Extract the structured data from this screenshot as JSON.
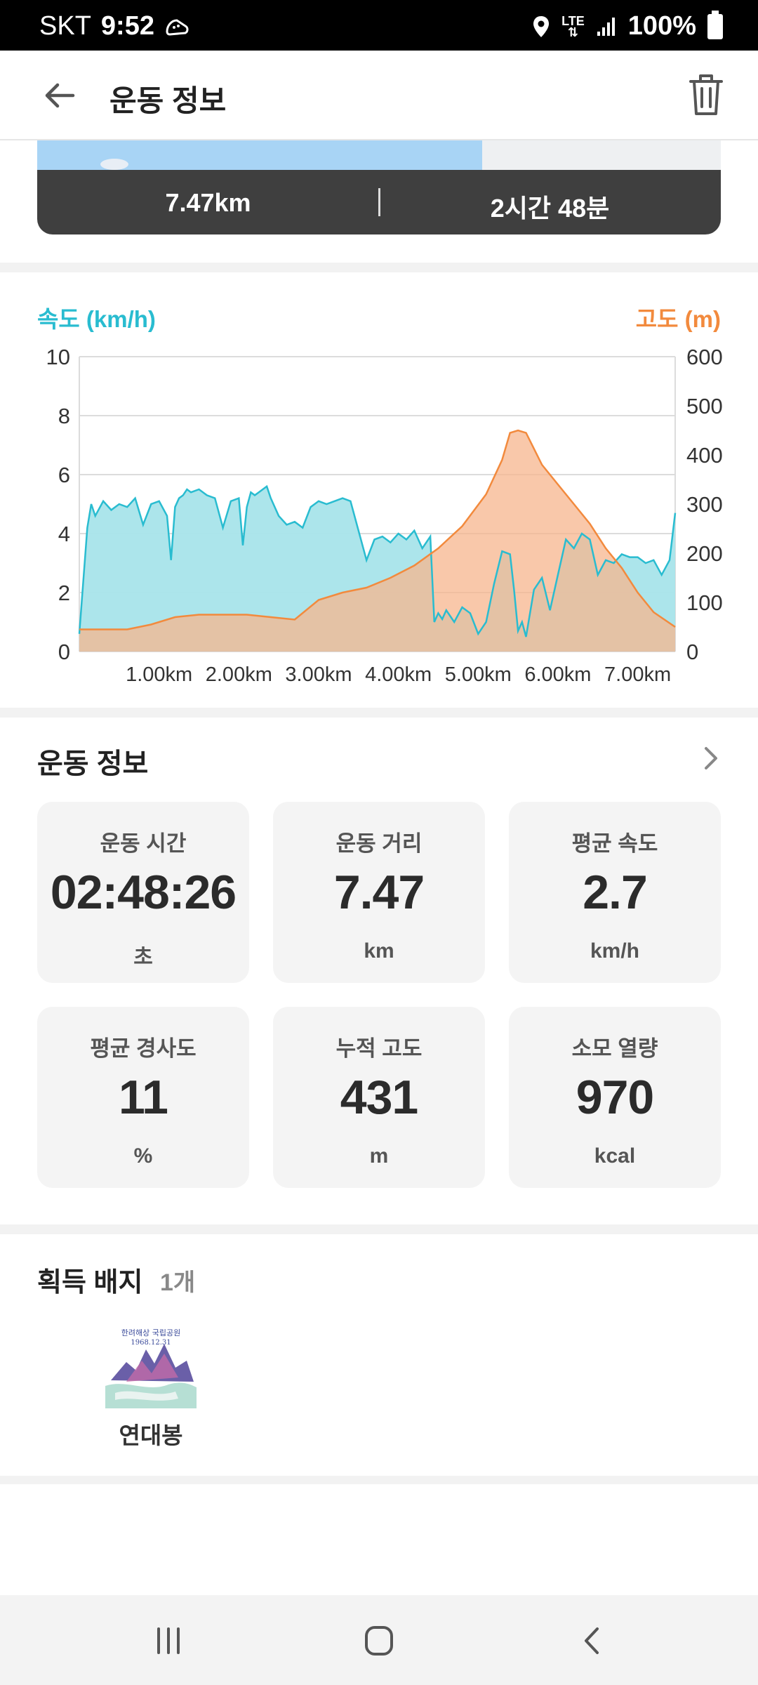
{
  "status_bar": {
    "carrier": "SKT",
    "time": "9:52",
    "network": "LTE",
    "battery": "100%"
  },
  "header": {
    "title": "운동 정보"
  },
  "summary": {
    "distance": "7.47km",
    "duration": "2시간 48분"
  },
  "chart": {
    "left_label": "속도 (km/h)",
    "right_label": "고도 (m)"
  },
  "chart_data": {
    "type": "area",
    "title": "",
    "xlabel": "",
    "x_ticks": [
      "1.00km",
      "2.00km",
      "3.00km",
      "4.00km",
      "5.00km",
      "6.00km",
      "7.00km"
    ],
    "xlim": [
      0,
      7.47
    ],
    "y_left": {
      "label": "속도 (km/h)",
      "ylim": [
        0,
        10
      ],
      "ticks": [
        "0",
        "2",
        "4",
        "6",
        "8",
        "10"
      ]
    },
    "y_right": {
      "label": "고도 (m)",
      "ylim": [
        0,
        600
      ],
      "ticks": [
        "0",
        "100",
        "200",
        "300",
        "400",
        "500",
        "600"
      ]
    },
    "grid": true,
    "colors": {
      "speed": "#29bcd0",
      "speed_fill": "#a8e4ea",
      "altitude": "#f28a3d",
      "altitude_fill": "#f7b58e",
      "overlap_fill": "#c8bda0"
    },
    "series": [
      {
        "name": "속도 (km/h)",
        "axis": "left",
        "x": [
          0,
          0.05,
          0.1,
          0.15,
          0.2,
          0.3,
          0.4,
          0.5,
          0.6,
          0.7,
          0.8,
          0.9,
          1.0,
          1.1,
          1.15,
          1.2,
          1.25,
          1.3,
          1.35,
          1.4,
          1.5,
          1.6,
          1.7,
          1.8,
          1.9,
          2.0,
          2.05,
          2.1,
          2.15,
          2.2,
          2.25,
          2.3,
          2.35,
          2.4,
          2.5,
          2.6,
          2.7,
          2.8,
          2.9,
          3.0,
          3.1,
          3.2,
          3.3,
          3.4,
          3.5,
          3.6,
          3.7,
          3.8,
          3.9,
          4.0,
          4.1,
          4.2,
          4.3,
          4.4,
          4.45,
          4.5,
          4.55,
          4.6,
          4.7,
          4.8,
          4.9,
          5.0,
          5.1,
          5.2,
          5.3,
          5.4,
          5.45,
          5.5,
          5.55,
          5.6,
          5.7,
          5.8,
          5.9,
          6.0,
          6.1,
          6.2,
          6.3,
          6.4,
          6.5,
          6.6,
          6.7,
          6.8,
          6.9,
          7.0,
          7.1,
          7.2,
          7.3,
          7.4,
          7.47
        ],
        "values": [
          0.6,
          2.4,
          4.2,
          5.0,
          4.6,
          5.1,
          4.8,
          5.0,
          4.9,
          5.2,
          4.3,
          5.0,
          5.1,
          4.6,
          3.1,
          4.9,
          5.2,
          5.3,
          5.5,
          5.4,
          5.5,
          5.3,
          5.2,
          4.2,
          5.1,
          5.2,
          3.6,
          4.9,
          5.4,
          5.3,
          5.4,
          5.5,
          5.6,
          5.2,
          4.6,
          4.3,
          4.4,
          4.2,
          4.9,
          5.1,
          5.0,
          5.1,
          5.2,
          5.1,
          4.1,
          3.1,
          3.8,
          3.9,
          3.7,
          4.0,
          3.8,
          4.1,
          3.5,
          3.9,
          1.0,
          1.3,
          1.1,
          1.4,
          1.0,
          1.5,
          1.3,
          0.6,
          1.0,
          2.3,
          3.4,
          3.3,
          2.1,
          0.7,
          1.0,
          0.5,
          2.1,
          2.5,
          1.4,
          2.6,
          3.8,
          3.5,
          4.0,
          3.8,
          2.6,
          3.1,
          3.0,
          3.3,
          3.2,
          3.2,
          3.0,
          3.1,
          2.6,
          3.1,
          4.7
        ]
      },
      {
        "name": "고도 (m)",
        "axis": "right",
        "x": [
          0,
          0.3,
          0.6,
          0.9,
          1.2,
          1.5,
          1.8,
          2.1,
          2.4,
          2.7,
          3.0,
          3.3,
          3.6,
          3.9,
          4.2,
          4.5,
          4.8,
          5.1,
          5.3,
          5.4,
          5.5,
          5.6,
          5.8,
          6.0,
          6.2,
          6.4,
          6.6,
          6.8,
          7.0,
          7.2,
          7.47
        ],
        "values": [
          45,
          45,
          45,
          55,
          70,
          75,
          75,
          75,
          70,
          65,
          105,
          120,
          130,
          150,
          175,
          210,
          255,
          320,
          390,
          445,
          450,
          445,
          380,
          340,
          300,
          260,
          210,
          170,
          120,
          80,
          50
        ]
      }
    ]
  },
  "exercise_info": {
    "title": "운동 정보",
    "cards": [
      {
        "label": "운동 시간",
        "value": "02:48:26",
        "unit": "초"
      },
      {
        "label": "운동 거리",
        "value": "7.47",
        "unit": "km"
      },
      {
        "label": "평균 속도",
        "value": "2.7",
        "unit": "km/h"
      },
      {
        "label": "평균 경사도",
        "value": "11",
        "unit": "%"
      },
      {
        "label": "누적 고도",
        "value": "431",
        "unit": "m"
      },
      {
        "label": "소모 열량",
        "value": "970",
        "unit": "kcal"
      }
    ]
  },
  "badges": {
    "title": "획득 배지",
    "count": "1개",
    "items": [
      {
        "name": "연대봉",
        "stamp_text": [
          "한려해상 국립공원",
          "1968.12.31"
        ]
      }
    ]
  }
}
